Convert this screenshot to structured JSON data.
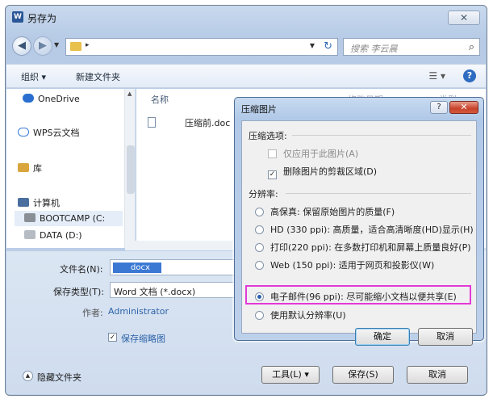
{
  "window": {
    "title": "另存为",
    "app_icon": "word-icon",
    "close_label": "✕"
  },
  "address": {
    "search_placeholder": "搜索 李云晨"
  },
  "toolbar": {
    "organize": "组织 ▾",
    "new_folder": "新建文件夹"
  },
  "nav": {
    "items": [
      "OneDrive",
      "WPS云文档",
      "库",
      "计算机",
      "BOOTCAMP (C:",
      "DATA (D:)"
    ]
  },
  "files": {
    "columns": [
      "名称",
      "修改日期",
      "类型"
    ],
    "rows": [
      {
        "name": "压缩前.doc"
      }
    ]
  },
  "form": {
    "filename_label": "文件名(N):",
    "filename_value": "docx",
    "filetype_label": "保存类型(T):",
    "filetype_value": "Word 文档 (*.docx)",
    "author_label": "作者:",
    "author_value": "Administrator",
    "thumbnail_label": "保存缩略图",
    "hide_folders": "隐藏文件夹",
    "tools_button": "工具(L)",
    "save_button": "保存(S)",
    "cancel_button": "取消"
  },
  "compress": {
    "title": "压缩图片",
    "help": "?",
    "close": "✕",
    "options_header": "压缩选项:",
    "option_only_this": "仅应用于此图片(A)",
    "option_delete_crop": "删除图片的剪裁区域(D)",
    "resolution_header": "分辨率:",
    "resolutions": [
      "高保真: 保留原始图片的质量(F)",
      "HD (330 ppi): 高质量，适合高清晰度(HD)显示(H)",
      "打印(220 ppi): 在多数打印机和屏幕上质量良好(P)",
      "Web (150 ppi): 适用于网页和投影仪(W)",
      "电子邮件(96 ppi): 尽可能缩小文档以便共享(E)",
      "使用默认分辨率(U)"
    ],
    "selected_index": 4,
    "ok": "确定",
    "cancel": "取消"
  },
  "colors": {
    "highlight": "#e23ad6",
    "accent": "#2a5fb0"
  }
}
